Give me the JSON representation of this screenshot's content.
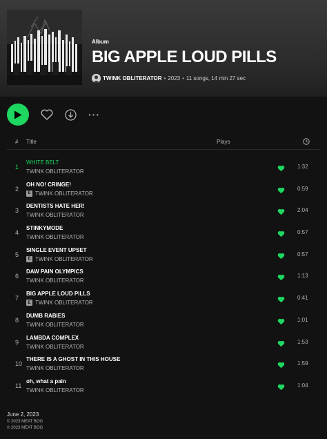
{
  "album": {
    "type_label": "Album",
    "title": "BIG APPLE LOUD PILLS",
    "artist": "TWINK OBLITERATOR",
    "separator": "•",
    "year": "2023",
    "stats": "11 songs, 14 min 27 sec"
  },
  "controls": {
    "play_icon": "play-icon",
    "like_icon": "heart-outline-icon",
    "download_icon": "download-icon",
    "more_label": "···"
  },
  "table_header": {
    "num": "#",
    "title": "Title",
    "plays": "Plays",
    "duration_icon": "clock-icon"
  },
  "colors": {
    "accent": "#1ed760",
    "background": "#121212",
    "muted": "#b3b3b3"
  },
  "tracks": [
    {
      "num": "1",
      "title": "WHITE BELT",
      "artist": "TWINK OBLITERATOR",
      "explicit": false,
      "duration": "1:32",
      "playing": true
    },
    {
      "num": "2",
      "title": "OH NO! CRINGE!",
      "artist": "TWINK OBLITERATOR",
      "explicit": true,
      "duration": "0:59",
      "playing": false
    },
    {
      "num": "3",
      "title": "DENTISTS HATE HER!",
      "artist": "TWINK OBLITERATOR",
      "explicit": false,
      "duration": "2:04",
      "playing": false
    },
    {
      "num": "4",
      "title": "STINKYMODE",
      "artist": "TWINK OBLITERATOR",
      "explicit": false,
      "duration": "0:57",
      "playing": false
    },
    {
      "num": "5",
      "title": "SINGLE EVENT UPSET",
      "artist": "TWINK OBLITERATOR",
      "explicit": true,
      "duration": "0:57",
      "playing": false
    },
    {
      "num": "6",
      "title": "DAW PAIN OLYMPICS",
      "artist": "TWINK OBLITERATOR",
      "explicit": false,
      "duration": "1:13",
      "playing": false
    },
    {
      "num": "7",
      "title": "BIG APPLE LOUD PILLS",
      "artist": "TWINK OBLITERATOR",
      "explicit": true,
      "duration": "0:41",
      "playing": false
    },
    {
      "num": "8",
      "title": "DUMB RABIES",
      "artist": "TWINK OBLITERATOR",
      "explicit": false,
      "duration": "1:01",
      "playing": false
    },
    {
      "num": "9",
      "title": "LAMBDA COMPLEX",
      "artist": "TWINK OBLITERATOR",
      "explicit": false,
      "duration": "1:53",
      "playing": false
    },
    {
      "num": "10",
      "title": "THERE IS A GHOST IN THIS HOUSE",
      "artist": "TWINK OBLITERATOR",
      "explicit": false,
      "duration": "1:59",
      "playing": false
    },
    {
      "num": "11",
      "title": "oh, what a pain",
      "artist": "TWINK OBLITERATOR",
      "explicit": false,
      "duration": "1:04",
      "playing": false
    }
  ],
  "explicit_badge": "E",
  "footer": {
    "release_date": "June 2, 2023",
    "copyright_c": "© 2023 MEAT BOG",
    "copyright_p": "℗ 2023 MEAT BOG"
  }
}
